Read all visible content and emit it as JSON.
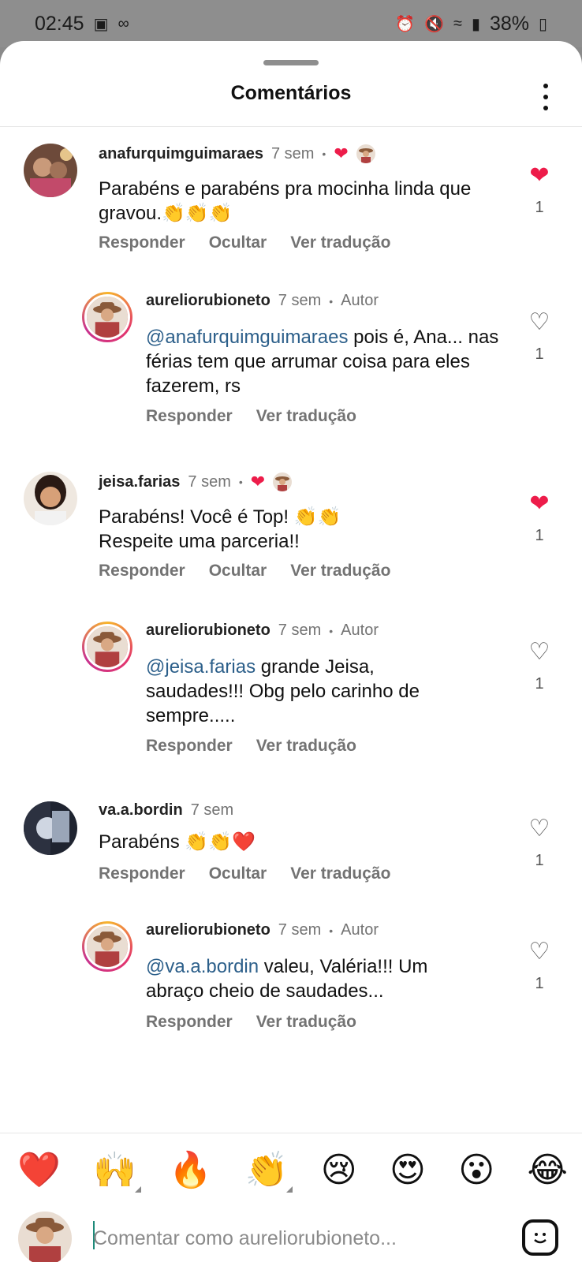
{
  "status_bar": {
    "time": "02:45",
    "battery": "38%",
    "icons": [
      "image-icon",
      "voicemail-icon",
      "alarm-icon",
      "mute-icon",
      "wifi-icon",
      "volte-icon",
      "signal-icon",
      "battery-icon"
    ]
  },
  "header": {
    "title": "Comentários"
  },
  "comments": [
    {
      "username": "anafurquimguimaraes",
      "time": "7 sem",
      "text": "Parabéns e parabéns pra mocinha linda que gravou.👏👏👏",
      "actions": [
        "Responder",
        "Ocultar",
        "Ver tradução"
      ],
      "likes": "1",
      "liked": true
    },
    {
      "username": "aureliorubioneto",
      "time": "7 sem",
      "author": "Autor",
      "mention": "@anafurquimguimaraes",
      "text": " pois é, Ana... nas férias tem que arrumar coisa para eles fazerem, rs",
      "actions": [
        "Responder",
        "Ver tradução"
      ],
      "likes": "1",
      "liked": false
    },
    {
      "username": "jeisa.farias",
      "time": "7 sem",
      "text_line1": "Parabéns! Você é Top! 👏👏",
      "text_line2": "Respeite uma parceria!!",
      "actions": [
        "Responder",
        "Ocultar",
        "Ver tradução"
      ],
      "likes": "1",
      "liked": true
    },
    {
      "username": "aureliorubioneto",
      "time": "7 sem",
      "author": "Autor",
      "mention": "@jeisa.farias",
      "text": " grande Jeisa, saudades!!! Obg pelo carinho de sempre.....",
      "actions": [
        "Responder",
        "Ver tradução"
      ],
      "likes": "1",
      "liked": false
    },
    {
      "username": "va.a.bordin",
      "time": "7 sem",
      "text": "Parabéns 👏👏❤️",
      "actions": [
        "Responder",
        "Ocultar",
        "Ver tradução"
      ],
      "likes": "1",
      "liked": false
    },
    {
      "username": "aureliorubioneto",
      "time": "7 sem",
      "author": "Autor",
      "mention": "@va.a.bordin",
      "text": " valeu, Valéria!!! Um abraço cheio de saudades...",
      "actions": [
        "Responder",
        "Ver tradução"
      ],
      "likes": "1",
      "liked": false
    }
  ],
  "quick_emojis": [
    "❤️",
    "🙌",
    "🔥",
    "👏",
    "😢",
    "😍",
    "😮",
    "😂"
  ],
  "composer": {
    "placeholder": "Comentar como aureliorubioneto..."
  },
  "colors": {
    "like_red": "#ed1c4a",
    "mention_blue": "#2c5f8a",
    "muted_gray": "#737373"
  }
}
